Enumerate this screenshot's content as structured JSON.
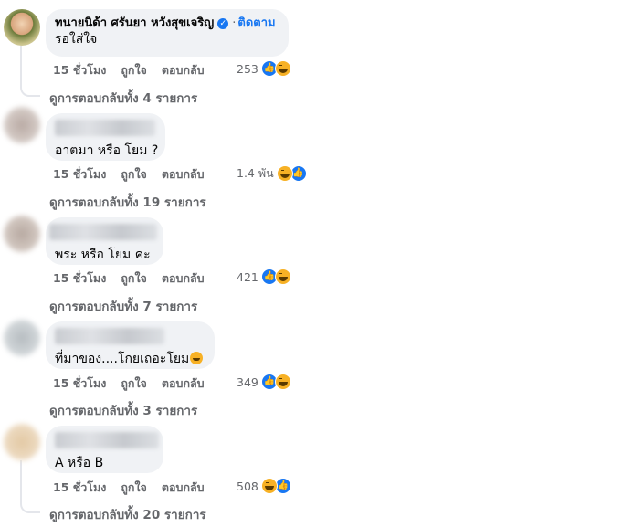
{
  "comments": [
    {
      "author": "ทนายนิด้า ศรันยา หวังสุขเจริญ",
      "verified": true,
      "follow_label": "ติดตาม",
      "text": "รอใส่ใจ",
      "time": "15 ชั่วโมง",
      "like_label": "ถูกใจ",
      "reply_label": "ตอบกลับ",
      "reaction_count": "253",
      "reactions": [
        "like-icon",
        "haha-icon"
      ],
      "replies_label": "ดูการตอบกลับทั้ง 4 รายการ"
    },
    {
      "author": "",
      "text": "อาตมา หรือ โยม ?",
      "time": "15 ชั่วโมง",
      "like_label": "ถูกใจ",
      "reply_label": "ตอบกลับ",
      "reaction_count": "1.4 พัน",
      "reactions": [
        "haha-icon",
        "like-icon"
      ],
      "replies_label": "ดูการตอบกลับทั้ง 19 รายการ"
    },
    {
      "author": "",
      "text": "พระ หรือ โยม คะ",
      "time": "15 ชั่วโมง",
      "like_label": "ถูกใจ",
      "reply_label": "ตอบกลับ",
      "reaction_count": "421",
      "reactions": [
        "like-icon",
        "haha-icon"
      ],
      "replies_label": "ดูการตอบกลับทั้ง 7 รายการ"
    },
    {
      "author": "",
      "text": "ที่มาของ....โกยเถอะโยม",
      "time": "15 ชั่วโมง",
      "like_label": "ถูกใจ",
      "reply_label": "ตอบกลับ",
      "reaction_count": "349",
      "reactions": [
        "like-icon",
        "haha-icon"
      ],
      "replies_label": "ดูการตอบกลับทั้ง 3 รายการ"
    },
    {
      "author": "",
      "text": "A หรือ B",
      "time": "15 ชั่วโมง",
      "like_label": "ถูกใจ",
      "reply_label": "ตอบกลับ",
      "reaction_count": "508",
      "reactions": [
        "haha-icon",
        "like-icon"
      ],
      "replies_label": "ดูการตอบกลับทั้ง 20 รายการ"
    }
  ],
  "colors": {
    "accent": "#1877f2",
    "bubble": "#f0f2f5",
    "muted": "#65676b"
  }
}
